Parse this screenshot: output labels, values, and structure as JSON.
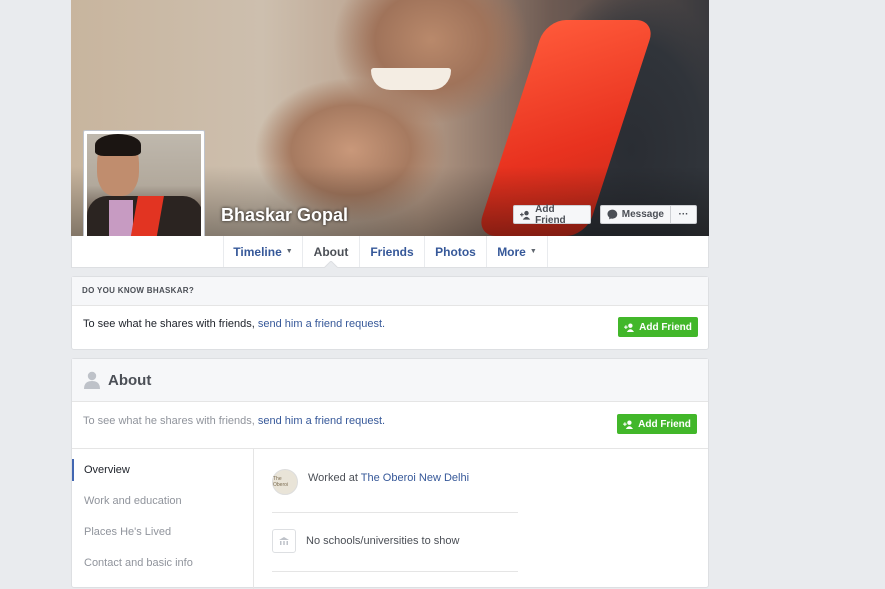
{
  "profile": {
    "name": "Bhaskar Gopal",
    "add_friend_label": "Add Friend",
    "message_label": "Message",
    "more_dots": "···"
  },
  "nav": {
    "tabs": [
      {
        "label": "Timeline",
        "has_caret": true
      },
      {
        "label": "About",
        "active": true
      },
      {
        "label": "Friends"
      },
      {
        "label": "Photos"
      },
      {
        "label": "More",
        "has_caret": true
      }
    ]
  },
  "know_box": {
    "heading": "DO YOU KNOW BHASKAR?",
    "text": "To see what he shares with friends, ",
    "link": "send him a friend request.",
    "button": "Add Friend"
  },
  "about": {
    "title": "About",
    "notice_text": "To see what he shares with friends, ",
    "notice_link": "send him a friend request.",
    "button": "Add Friend",
    "sidebar": [
      "Overview",
      "Work and education",
      "Places He's Lived",
      "Contact and basic info"
    ],
    "work_prefix": "Worked at ",
    "work_link": "The Oberoi New Delhi",
    "work_logo_text": "The Oberoi",
    "school_text": "No schools/universities to show"
  },
  "colors": {
    "accent": "#4267b2",
    "link": "#365899",
    "green": "#42b72a",
    "background": "#e9ebee"
  },
  "icons": [
    "add-friend-icon",
    "messenger-icon",
    "person-icon",
    "school-icon"
  ]
}
